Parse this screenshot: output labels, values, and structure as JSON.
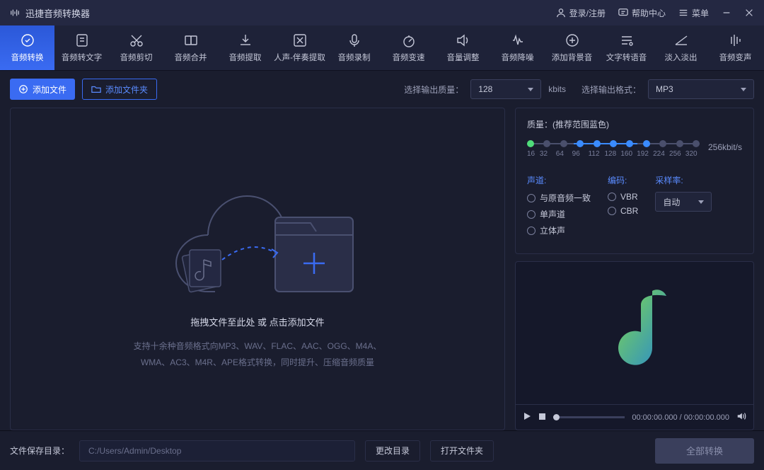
{
  "app": {
    "title": "迅捷音频转换器"
  },
  "titlebar": {
    "login": "登录/注册",
    "help": "帮助中心",
    "menu": "菜单"
  },
  "tools": [
    {
      "label": "音频转换",
      "icon": "convert",
      "active": true
    },
    {
      "label": "音频转文字",
      "icon": "stt"
    },
    {
      "label": "音频剪切",
      "icon": "cut"
    },
    {
      "label": "音频合并",
      "icon": "merge"
    },
    {
      "label": "音频提取",
      "icon": "extract"
    },
    {
      "label": "人声-伴奏提取",
      "icon": "split"
    },
    {
      "label": "音频录制",
      "icon": "record"
    },
    {
      "label": "音频变速",
      "icon": "speed"
    },
    {
      "label": "音量调整",
      "icon": "volume"
    },
    {
      "label": "音频降噪",
      "icon": "denoise"
    },
    {
      "label": "添加背景音",
      "icon": "bgm"
    },
    {
      "label": "文字转语音",
      "icon": "tts"
    },
    {
      "label": "淡入淡出",
      "icon": "fade"
    },
    {
      "label": "音频变声",
      "icon": "voice"
    }
  ],
  "actionbar": {
    "add_file": "添加文件",
    "add_folder": "添加文件夹",
    "quality_label": "选择输出质量：",
    "quality_value": "128",
    "quality_unit": "kbits",
    "format_label": "选择输出格式：",
    "format_value": "MP3"
  },
  "dropzone": {
    "main_text": "拖拽文件至此处 或 点击添加文件",
    "sub_line1": "支持十余种音频格式向MP3、WAV、FLAC、AAC、OGG、M4A、",
    "sub_line2": "WMA、AC3、M4R、APE格式转换，同时提升、压缩音频质量"
  },
  "quality_panel": {
    "title": "质量：(推荐范围蓝色)",
    "unit": "256kbit/s",
    "ticks": [
      "16",
      "32",
      "64",
      "96",
      "112",
      "128",
      "160",
      "192",
      "224",
      "256",
      "320"
    ],
    "channel": {
      "title": "声道:",
      "opts": [
        "与原音频一致",
        "单声道",
        "立体声"
      ]
    },
    "encoding": {
      "title": "编码:",
      "opts": [
        "VBR",
        "CBR"
      ]
    },
    "samplerate": {
      "title": "采样率:",
      "value": "自动"
    }
  },
  "player": {
    "time_cur": "00:00:00.000",
    "time_total": "00:00:00.000"
  },
  "footer": {
    "save_label": "文件保存目录：",
    "path": "C:/Users/Admin/Desktop",
    "change_dir": "更改目录",
    "open_folder": "打开文件夹",
    "convert_all": "全部转换"
  }
}
